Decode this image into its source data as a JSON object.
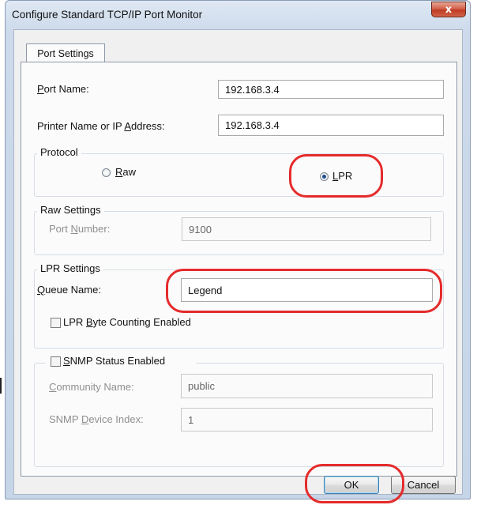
{
  "window": {
    "title": "Configure Standard TCP/IP Port Monitor",
    "close_glyph": "x"
  },
  "tabs": [
    {
      "label": "Port Settings"
    }
  ],
  "port_name": {
    "label_mnemonic": "P",
    "label_rest": "ort Name:",
    "value": "192.168.3.4"
  },
  "printer_address": {
    "label_pre": "Printer Name or IP ",
    "label_mnemonic": "A",
    "label_rest": "ddress:",
    "value": "192.168.3.4"
  },
  "protocol": {
    "legend": "Protocol",
    "raw": {
      "mnemonic": "R",
      "rest": "aw",
      "selected": false
    },
    "lpr": {
      "mnemonic": "L",
      "rest": "PR",
      "selected": true
    }
  },
  "raw_settings": {
    "legend": "Raw Settings",
    "port_number": {
      "label_pre": "Port ",
      "label_mnemonic": "N",
      "label_rest": "umber:",
      "value": "9100"
    }
  },
  "lpr_settings": {
    "legend": "LPR Settings",
    "queue_name": {
      "label_mnemonic": "Q",
      "label_rest": "ueue Name:",
      "value": "Legend"
    },
    "byte_counting": {
      "label_pre": "LPR ",
      "label_mnemonic": "B",
      "label_rest": "yte Counting Enabled",
      "checked": false
    }
  },
  "snmp": {
    "status": {
      "label_mnemonic": "S",
      "label_rest": "NMP Status Enabled",
      "checked": false
    },
    "community_name": {
      "label_mnemonic": "C",
      "label_rest": "ommunity Name:",
      "value": "public"
    },
    "device_index": {
      "label_pre": "SNMP ",
      "label_mnemonic": "D",
      "label_rest": "evice Index:",
      "value": "1"
    }
  },
  "buttons": {
    "ok": "OK",
    "cancel": "Cancel"
  },
  "colors": {
    "highlight_callout": "#e52b2b",
    "close_button": "#c7422a",
    "radio_selected_dot": "#1f4f8f",
    "default_button_border": "#3c7fb1"
  }
}
